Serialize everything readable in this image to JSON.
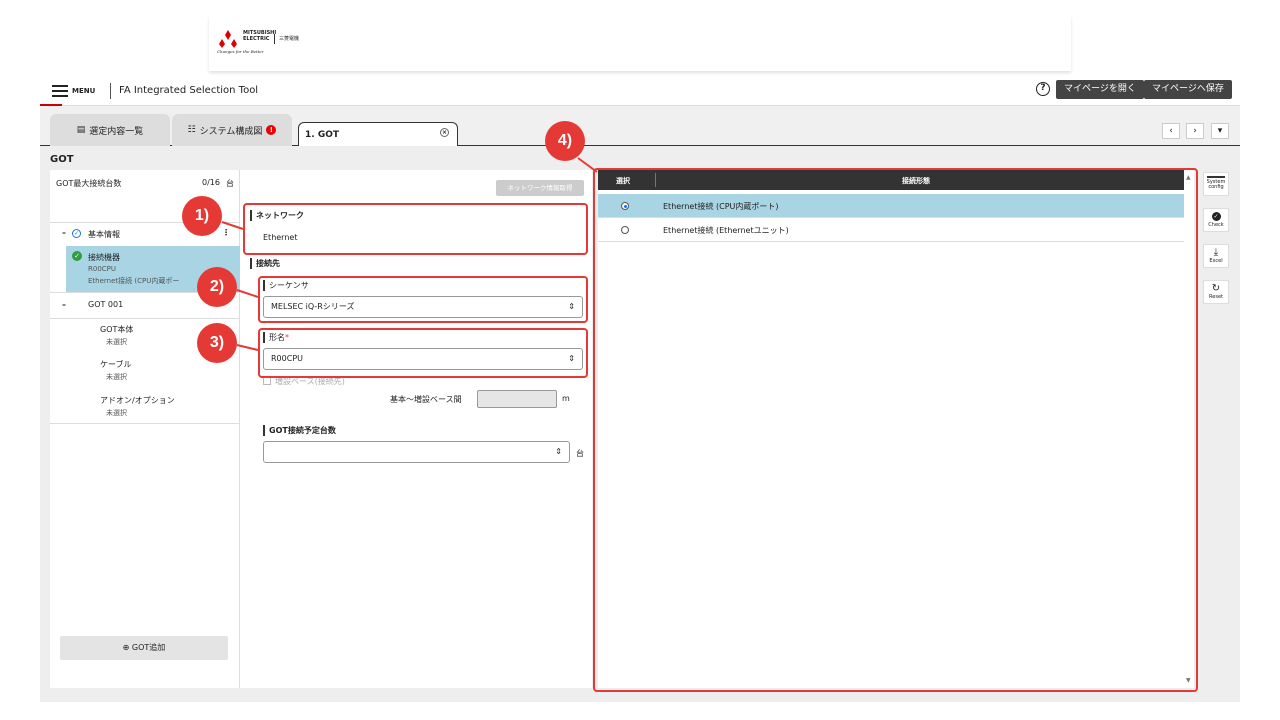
{
  "brand": {
    "logo_line1": "MITSUBISHI",
    "logo_line2": "ELECTRIC",
    "tagline": "Changes for the Better",
    "logo_jp": "三菱電機"
  },
  "header": {
    "menu_label": "MENU",
    "app_title": "FA Integrated Selection Tool",
    "btn_open": "マイページを開く",
    "btn_save": "マイページへ保存"
  },
  "tabs": [
    {
      "label": "選定内容一覧"
    },
    {
      "label": "システム構成図"
    },
    {
      "label": "1. GOT"
    }
  ],
  "page_title": "GOT",
  "left": {
    "max_label": "GOT最大接続台数",
    "max_value": "0/16",
    "max_unit": "台",
    "basic_info": "基本情報",
    "conn_device": "接続機器",
    "conn_device_sub1": "R00CPU",
    "conn_device_sub2": "Ethernet接続 (CPU内蔵ポー",
    "got001": "GOT 001",
    "got_body": "GOT本体",
    "got_body_sub": "未選択",
    "cable": "ケーブル",
    "cable_sub": "未選択",
    "addon": "アドオン/オプション",
    "addon_sub": "未選択",
    "add_btn": "GOT追加"
  },
  "middle": {
    "network_btn": "ネットワーク情報取得",
    "network_label": "ネットワーク",
    "network_value": "Ethernet",
    "dest_label": "接続先",
    "sequencer_label": "シーケンサ",
    "sequencer_value": "MELSEC iQ-Rシリーズ",
    "model_label": "形名",
    "model_required": "*",
    "model_value": "R00CPU",
    "ext_base_label": "増設ベース(接続先)",
    "base_distance_label": "基本～増設ベース間",
    "base_distance_unit": "m",
    "got_count_label": "GOT接続予定台数",
    "got_count_unit": "台"
  },
  "right": {
    "col_select": "選択",
    "col_form": "接続形態",
    "rows": [
      {
        "label": "Ethernet接続 (CPU内蔵ポート)",
        "selected": true
      },
      {
        "label": "Ethernet接続 (Ethernetユニット)",
        "selected": false
      }
    ]
  },
  "side_tools": [
    {
      "label": "System config"
    },
    {
      "label": "Check"
    },
    {
      "label": "Excel"
    },
    {
      "label": "Reset"
    }
  ],
  "callouts": [
    "1)",
    "2)",
    "3)",
    "4)"
  ],
  "colors": {
    "accent_red": "#e53935",
    "selected_row": "#a8d4e4",
    "dark_button": "#444444"
  }
}
